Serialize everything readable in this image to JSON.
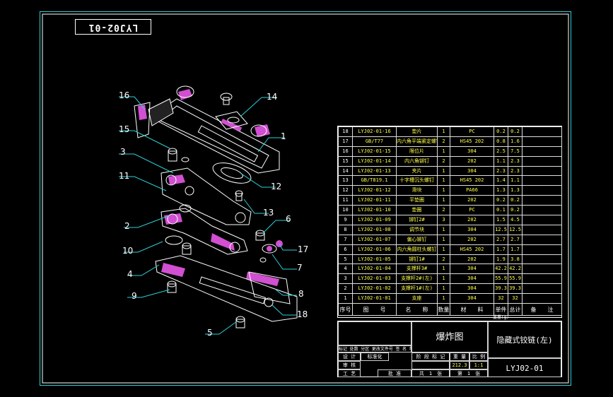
{
  "drawing_title_stamp": "LYJ02-01",
  "callouts": [
    "16",
    "14",
    "15",
    "3",
    "1",
    "11",
    "12",
    "13",
    "2",
    "6",
    "10",
    "17",
    "4",
    "7",
    "9",
    "8",
    "18",
    "5"
  ],
  "bom": {
    "header": [
      "序号",
      "图　　号",
      "名　　称",
      "数量",
      "材　　料",
      "单件",
      "总计",
      "备　　注"
    ],
    "header_sub": "重量(g)",
    "rows": [
      [
        "18",
        "LYJ02-01-16",
        "垫片",
        "1",
        "PC",
        "0.2",
        "0.2",
        ""
      ],
      [
        "17",
        "GB/T77",
        "内六角平端紧定螺钉",
        "2",
        "HS45 202",
        "0.8",
        "1.6",
        ""
      ],
      [
        "16",
        "LYJ02-01-15",
        "限位片",
        "1",
        "304",
        "2.5",
        "7.5",
        ""
      ],
      [
        "15",
        "LYJ02-01-14",
        "内六角铆钉",
        "2",
        "202",
        "1.1",
        "2.3",
        ""
      ],
      [
        "14",
        "LYJ02-01-13",
        "夹片",
        "1",
        "304",
        "2.3",
        "2.3",
        ""
      ],
      [
        "13",
        "GB/T819.1",
        "十字槽沉头螺钉",
        "1",
        "HS45 202",
        "1.4",
        "1.1",
        ""
      ],
      [
        "12",
        "LYJ02-01-12",
        "滑块",
        "1",
        "PA66",
        "1.3",
        "1.3",
        ""
      ],
      [
        "11",
        "LYJ02-01-11",
        "平垫圈",
        "1",
        "202",
        "0.2",
        "0.2",
        ""
      ],
      [
        "10",
        "LYJ02-01-10",
        "垫圈",
        "2",
        "PC",
        "0.1",
        "0.2",
        ""
      ],
      [
        "9",
        "LYJ02-01-09",
        "铆钉2#",
        "3",
        "202",
        "1.5",
        "4.5",
        ""
      ],
      [
        "8",
        "LYJ02-01-08",
        "调节块",
        "1",
        "304",
        "12.5",
        "12.5",
        ""
      ],
      [
        "7",
        "LYJ02-01-07",
        "偏心铆钉",
        "1",
        "202",
        "2.7",
        "2.7",
        ""
      ],
      [
        "6",
        "LYJ02-01-06",
        "内六角圆柱头螺钉",
        "1",
        "HS45 202",
        "1.7",
        "1.7",
        ""
      ],
      [
        "5",
        "LYJ02-01-05",
        "铆钉1#",
        "2",
        "202",
        "1.9",
        "3.8",
        ""
      ],
      [
        "4",
        "LYJ02-01-04",
        "支撑杆3#",
        "1",
        "304",
        "42.2",
        "42.2",
        ""
      ],
      [
        "3",
        "LYJ02-01-03",
        "支撑杆2#(左)",
        "1",
        "304",
        "55.9",
        "55.9",
        ""
      ],
      [
        "2",
        "LYJ02-01-02",
        "支撑杆1#(左)",
        "1",
        "304",
        "39.3",
        "39.3",
        ""
      ],
      [
        "1",
        "LYJ02-01-01",
        "支座",
        "1",
        "304",
        "32",
        "32",
        ""
      ]
    ]
  },
  "title_block": {
    "view_name": "爆炸图",
    "part_name": "隐藏式铰链(左)",
    "drawing_no": "LYJ02-01",
    "labels": {
      "mark_row": "标记 处数 分区 更改文件号 签 名 年月日",
      "design": "设 计",
      "standard": "标准化",
      "review": "审 核",
      "process": "工 艺",
      "approve": "批 准",
      "stage": "阶 段 标 记",
      "weight": "重 量",
      "scale": "比 例",
      "sheets": "共　1　张",
      "sheet_no": "第　1　张",
      "weight_val": "212.3",
      "scale_val": "1:1"
    }
  }
}
